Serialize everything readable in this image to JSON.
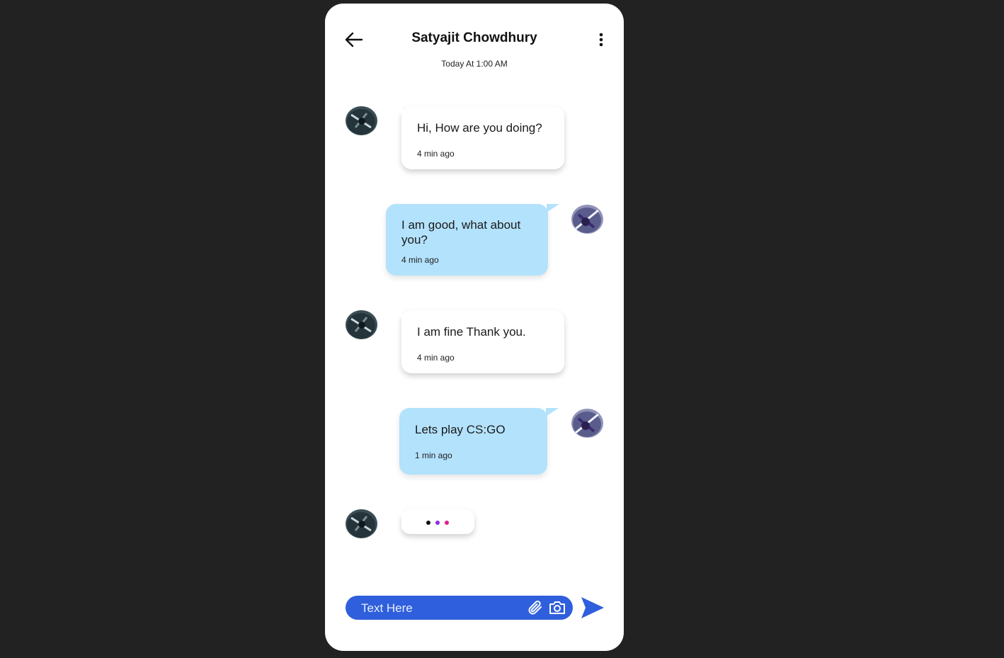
{
  "header": {
    "title": "Satyajit Chowdhury",
    "subtitle": "Today At 1:00 AM",
    "back_icon": "arrow-left-icon",
    "menu_icon": "more-vertical-icon"
  },
  "messages": [
    {
      "direction": "incoming",
      "text": "Hi, How are you doing?",
      "time": "4 min ago"
    },
    {
      "direction": "outgoing",
      "text": "I am good, what about you?",
      "time": "4 min ago"
    },
    {
      "direction": "incoming",
      "text": "I am fine Thank you.",
      "time": "4 min ago"
    },
    {
      "direction": "outgoing",
      "text": "Lets play CS:GO",
      "time": "1 min ago"
    }
  ],
  "typing_indicator": {
    "dot_colors": [
      "#111111",
      "#8e2de2",
      "#e0208f"
    ]
  },
  "composer": {
    "placeholder": "Text Here",
    "attach_icon": "paperclip-icon",
    "camera_icon": "camera-icon",
    "send_icon": "send-icon"
  },
  "colors": {
    "background": "#222222",
    "outgoing_bubble": "#b3e2fc",
    "incoming_bubble": "#ffffff",
    "accent": "#2f5fdc"
  }
}
